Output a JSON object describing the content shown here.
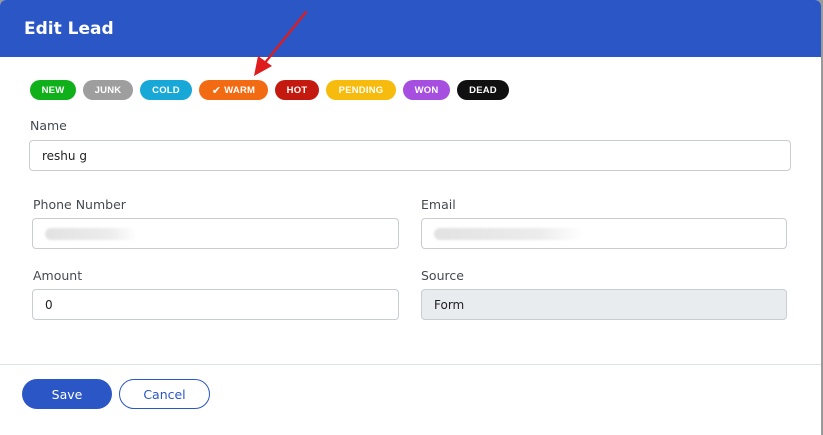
{
  "modal": {
    "title": "Edit Lead"
  },
  "statuses": [
    {
      "label": "NEW",
      "color": "#10b01a",
      "selected": false
    },
    {
      "label": "JUNK",
      "color": "#9e9e9e",
      "selected": false
    },
    {
      "label": "COLD",
      "color": "#17a8d8",
      "selected": false
    },
    {
      "label": "WARM",
      "color": "#f26b12",
      "selected": true
    },
    {
      "label": "HOT",
      "color": "#c4190e",
      "selected": false
    },
    {
      "label": "PENDING",
      "color": "#f6bb0c",
      "selected": false
    },
    {
      "label": "WON",
      "color": "#a64ee0",
      "selected": false
    },
    {
      "label": "DEAD",
      "color": "#101010",
      "selected": false
    }
  ],
  "form": {
    "name": {
      "label": "Name",
      "value": "reshu g"
    },
    "phone": {
      "label": "Phone Number",
      "value": ""
    },
    "email": {
      "label": "Email",
      "value": ""
    },
    "amount": {
      "label": "Amount",
      "value": "0"
    },
    "source": {
      "label": "Source",
      "value": "Form"
    }
  },
  "footer": {
    "save_label": "Save",
    "cancel_label": "Cancel"
  },
  "colors": {
    "primary": "#2a56c6",
    "annotation_arrow": "#e01b1b"
  },
  "icons": {
    "selected_status": "check-icon",
    "annotation": "red-arrow-icon"
  }
}
